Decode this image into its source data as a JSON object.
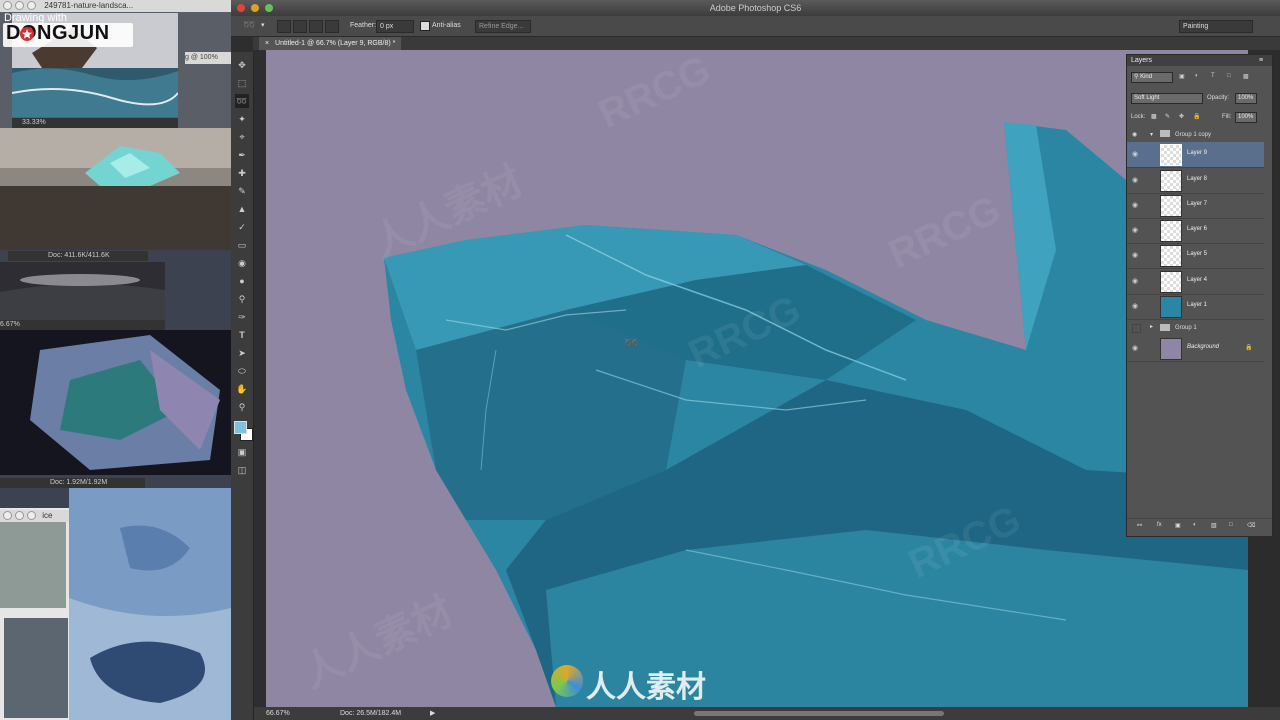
{
  "app": {
    "title": "Adobe Photoshop CS6",
    "workspace": "Painting",
    "doc_tab": "Untitled-1 @ 66.7% (Layer 9, RGB/8) *"
  },
  "branding": {
    "drawing_with": "Drawing with",
    "name": "DONGJUN"
  },
  "options_bar": {
    "feather_label": "Feather:",
    "feather_value": "0 px",
    "antialias_label": "Anti-alias",
    "refine_edge": "Refine Edge..."
  },
  "refs": {
    "win1_title": "249781-nature-landsca...",
    "win1_tail": "g @ 100%",
    "win1_zoom": "33.33%",
    "win2_doc": "Doc: 411.6K/411.6K",
    "win3_zoom": "6.67%",
    "win4_doc": "Doc: 1.92M/1.92M",
    "win5_title": "ice"
  },
  "status": {
    "zoom": "66.67%",
    "doc": "Doc: 26.5M/182.4M"
  },
  "layers_panel": {
    "tab": "Layers",
    "kind": "Kind",
    "blend_mode": "Soft Light",
    "opacity_label": "Opacity:",
    "opacity_value": "100%",
    "lock_label": "Lock:",
    "fill_label": "Fill:",
    "fill_value": "100%",
    "group_copy": "Group 1 copy",
    "layers": [
      "Layer 9",
      "Layer 8",
      "Layer 7",
      "Layer 6",
      "Layer 5",
      "Layer 4",
      "Layer 1"
    ],
    "group": "Group 1",
    "background": "Background"
  },
  "watermarks": [
    "RRCG",
    "人人素材",
    "人人素材"
  ],
  "colors": {
    "canvas_bg": "#8f86a3",
    "ice": "#2a86a3",
    "foreground_swatch": "#7fc0e0",
    "selected_layer": "#5a6f8e"
  }
}
